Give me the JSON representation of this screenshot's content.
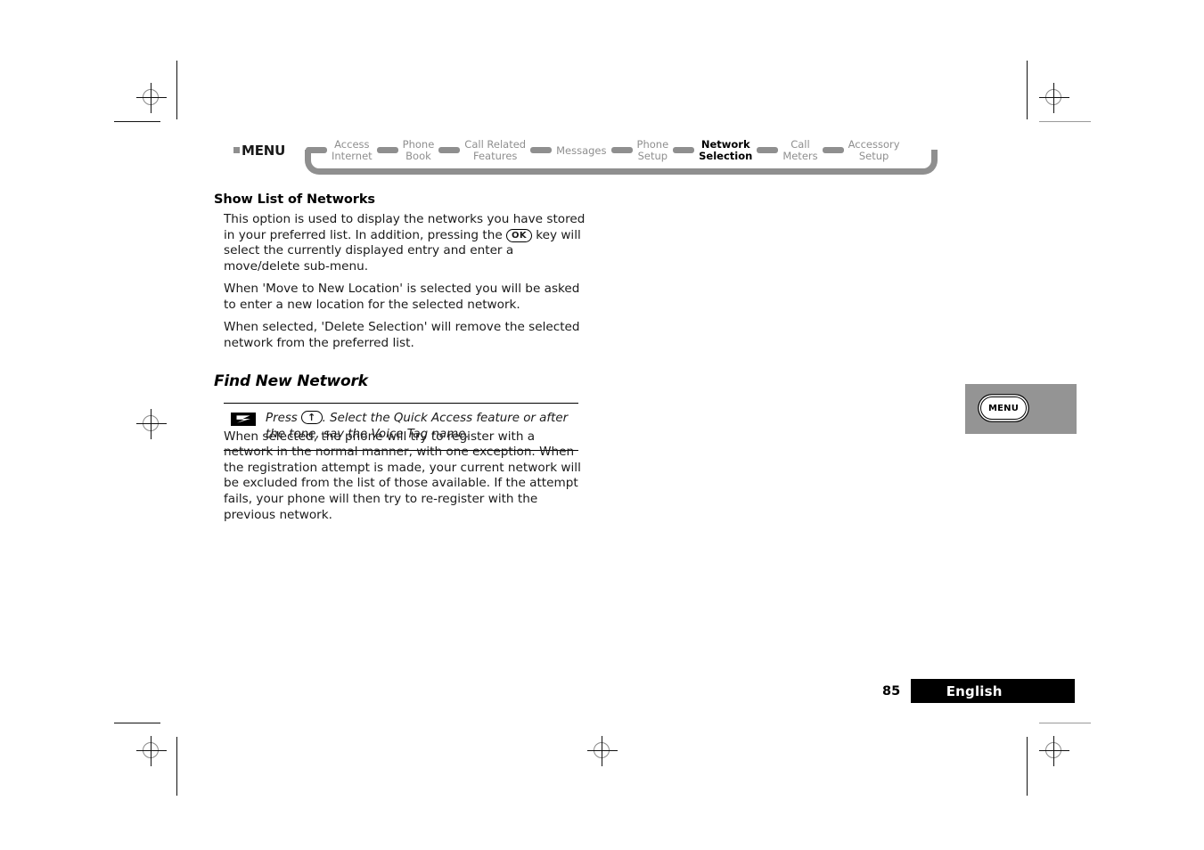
{
  "menu_path": {
    "root_label": "MENU",
    "items": [
      {
        "label": "Access\nInternet",
        "active": false
      },
      {
        "label": "Phone\nBook",
        "active": false
      },
      {
        "label": "Call Related\nFeatures",
        "active": false
      },
      {
        "label": "Messages",
        "active": false
      },
      {
        "label": "Phone\nSetup",
        "active": false
      },
      {
        "label": "Network\nSelection",
        "active": true
      },
      {
        "label": "Call\nMeters",
        "active": false
      },
      {
        "label": "Accessory\nSetup",
        "active": false
      }
    ],
    "colors": {
      "inactive": "#8f8f8f",
      "active": "#000000"
    }
  },
  "content": {
    "section_heading": "Show List of Networks",
    "paragraph_1_a": "This option is used to display the networks you have stored in your preferred list. In addition, pressing the ",
    "ok_key_label": "OK",
    "paragraph_1_b": " key will select the currently displayed entry and enter a move/delete sub-menu.",
    "paragraph_2": "When 'Move to New Location' is selected you will be asked to enter a new location for the selected network.",
    "paragraph_3": "When selected, 'Delete Selection' will remove the selected network from the preferred list.",
    "heading_2": "Find New Network",
    "tip": {
      "icon": "lightning-bolt-icon",
      "text_a": "Press ",
      "arrow_key_label": "↑",
      "text_b": ". Select the Quick Access feature or after the tone, say the Voice Tag name."
    },
    "paragraph_4": "When selected, the phone will try to register with a network in the normal manner, with one exception. When the registration attempt is made, your current network will be excluded from the list of those available. If the attempt fails, your phone will then try to re-register with the previous network."
  },
  "key_illustration": {
    "key_label": "MENU",
    "background_color": "#949494"
  },
  "footer": {
    "page_number": "85",
    "language": "English",
    "bar_color": "#000000"
  }
}
